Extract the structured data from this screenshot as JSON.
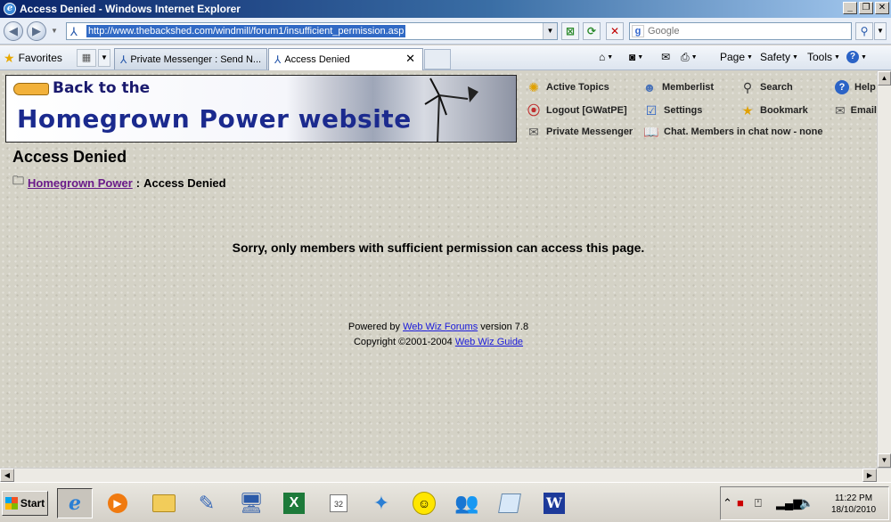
{
  "window": {
    "title": "Access Denied - Windows Internet Explorer"
  },
  "addressbar": {
    "url": "http://www.thebackshed.com/windmill/forum1/insufficient_permission.asp",
    "search_placeholder": "Google"
  },
  "favorites_bar": {
    "favorites_label": "Favorites",
    "tabs": [
      {
        "label": "Private Messenger : Send N..."
      },
      {
        "label": "Access Denied"
      }
    ],
    "commands": {
      "page": "Page",
      "safety": "Safety",
      "tools": "Tools"
    }
  },
  "banner": {
    "back_to": "Back to the",
    "site_name": "Homegrown Power website"
  },
  "forum_nav": {
    "active_topics": "Active Topics",
    "memberlist": "Memberlist",
    "search": "Search",
    "help": "Help",
    "logout": "Logout [GWatPE]",
    "settings": "Settings",
    "bookmark": "Bookmark",
    "email": "Email",
    "private_messenger": "Private Messenger",
    "chat": "Chat. Members in chat now - none"
  },
  "page": {
    "title": "Access Denied",
    "breadcrumb_link": "Homegrown Power",
    "breadcrumb_sep": ":",
    "breadcrumb_current": "Access Denied",
    "message": "Sorry, only members with sufficient permission can access this page.",
    "powered_by_prefix": "Powered by",
    "powered_by_link": "Web Wiz Forums",
    "version": "version 7.8",
    "copyright_prefix": "Copyright ©2001-2004",
    "copyright_link": "Web Wiz Guide"
  },
  "taskbar": {
    "start_label": "Start",
    "clock_time": "11:22 PM",
    "clock_date": "18/10/2010"
  }
}
